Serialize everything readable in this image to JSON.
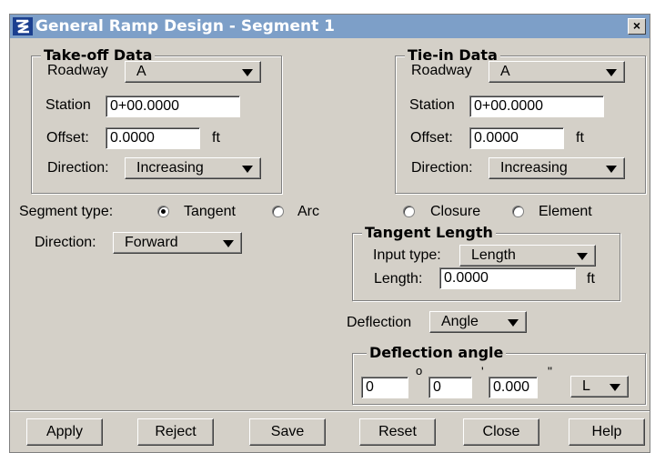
{
  "window": {
    "title": "General Ramp Design - Segment 1",
    "close_label": "×"
  },
  "takeoff": {
    "title": "Take-off Data",
    "roadway_label": "Roadway",
    "roadway_value": "A",
    "station_label": "Station",
    "station_value": "0+00.0000",
    "offset_label": "Offset:",
    "offset_value": "0.0000",
    "offset_unit": "ft",
    "direction_label": "Direction:",
    "direction_value": "Increasing"
  },
  "tiein": {
    "title": "Tie-in Data",
    "roadway_label": "Roadway",
    "roadway_value": "A",
    "station_label": "Station",
    "station_value": "0+00.0000",
    "offset_label": "Offset:",
    "offset_value": "0.0000",
    "offset_unit": "ft",
    "direction_label": "Direction:",
    "direction_value": "Increasing"
  },
  "segment": {
    "type_label": "Segment type:",
    "options": [
      "Tangent",
      "Arc",
      "Closure",
      "Element"
    ],
    "selected": "Tangent",
    "direction_label": "Direction:",
    "direction_value": "Forward"
  },
  "tangent": {
    "title": "Tangent Length",
    "input_type_label": "Input type:",
    "input_type_value": "Length",
    "length_label": "Length:",
    "length_value": "0.0000",
    "length_unit": "ft"
  },
  "deflection": {
    "label": "Deflection",
    "value": "Angle",
    "angle_title": "Deflection angle",
    "degrees": "0",
    "degree_symbol": "o",
    "minutes": "0",
    "minute_symbol": "'",
    "seconds": "0.000",
    "second_symbol": "\"",
    "side": "L"
  },
  "buttons": {
    "apply": "Apply",
    "reject": "Reject",
    "save": "Save",
    "reset": "Reset",
    "close": "Close",
    "help": "Help"
  }
}
